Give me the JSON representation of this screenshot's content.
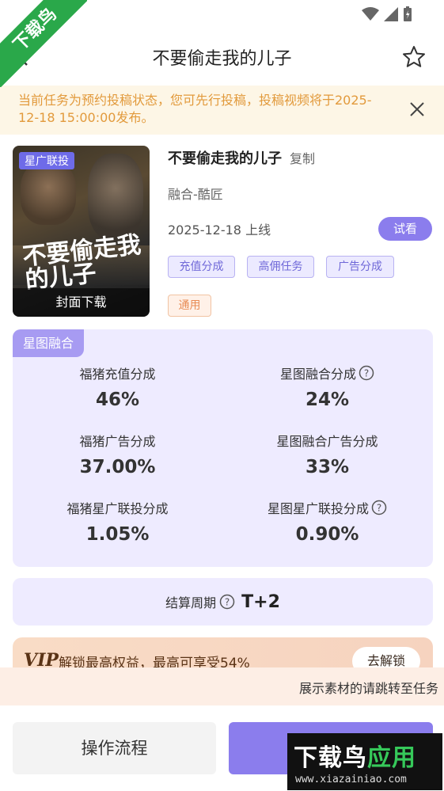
{
  "watermark": {
    "corner_text": "下载鸟",
    "brand_text_main": "下载鸟",
    "brand_text_sub": "应用",
    "site": "www.xiazainiao.com"
  },
  "header": {
    "title": "不要偷走我的儿子"
  },
  "notice": {
    "text": "当前任务为预约投稿状态，您可先行投稿，投稿视频将于2025-12-18 15:00:00发布。"
  },
  "drama": {
    "cover_tag": "星广联投",
    "cover_art_title": "不要偷走我的儿子",
    "cover_download": "封面下载",
    "name": "不要偷走我的儿子",
    "copy_label": "复制",
    "author": "融合-酷匠",
    "release": "2025-12-18 上线",
    "trial_label": "试看",
    "tags": [
      "充值分成",
      "高佣任务",
      "广告分成",
      "通用"
    ]
  },
  "share": {
    "label": "星图融合",
    "items": [
      {
        "key": "福猪充值分成",
        "value": "46%",
        "help": false
      },
      {
        "key": "星图融合分成",
        "value": "24%",
        "help": true
      },
      {
        "key": "福猪广告分成",
        "value": "37.00%",
        "help": false
      },
      {
        "key": "星图融合广告分成",
        "value": "33%",
        "help": false
      },
      {
        "key": "福猪星广联投分成",
        "value": "1.05%",
        "help": false
      },
      {
        "key": "星图星广联投分成",
        "value": "0.90%",
        "help": true
      }
    ]
  },
  "period": {
    "label": "结算周期",
    "value": "T+2"
  },
  "vip": {
    "logo": "VIP",
    "text": "解锁最高权益，最高可享受54%",
    "button": "去解锁"
  },
  "hint": {
    "text": "展示素材的请跳转至任务"
  },
  "bottom": {
    "flow_label": "操作流程"
  },
  "colors": {
    "accent": "#8b7ded",
    "notice_text": "#e29a3c",
    "share_bg": "#eeebff"
  }
}
